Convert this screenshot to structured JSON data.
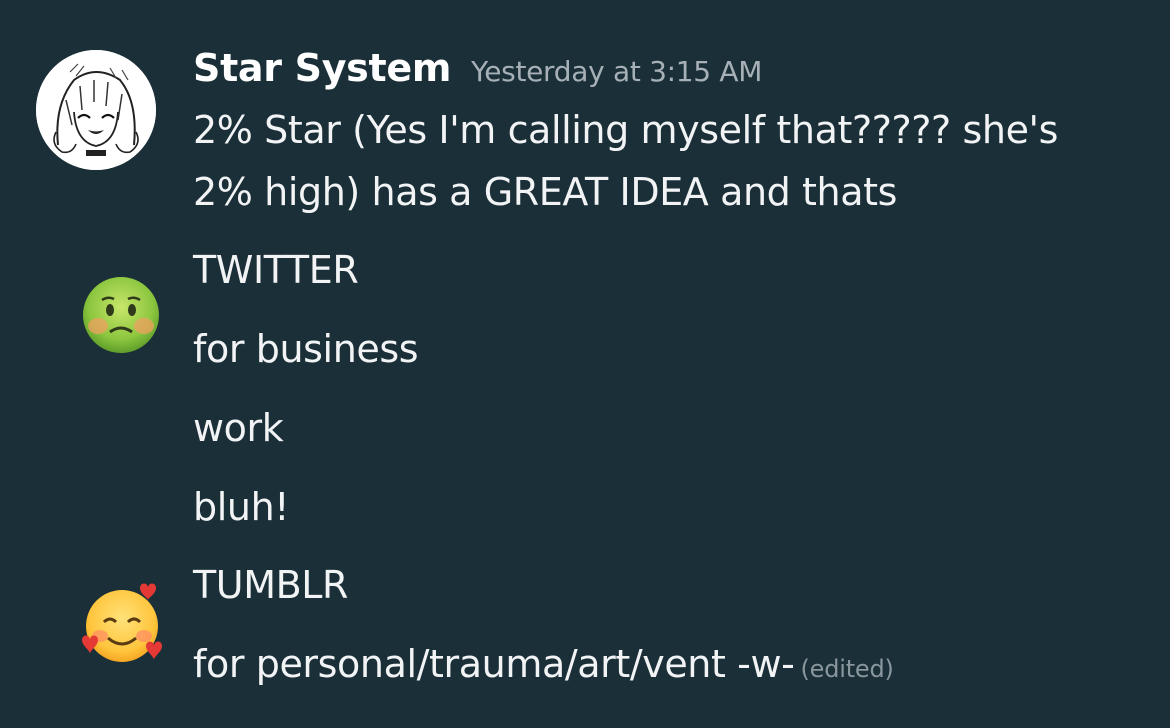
{
  "message": {
    "author": "Star System",
    "timestamp": "Yesterday at 3:15 AM",
    "lines": [
      "2% Star (Yes I'm calling myself that????? she's",
      "2% high) has a GREAT IDEA and thats",
      "TWITTER",
      "for business",
      "work",
      "bluh!",
      "TUMBLR",
      "for personal/trauma/art/vent -w-"
    ],
    "edited_label": "(edited)"
  },
  "emojis": {
    "sick": "nauseated-face-emoji",
    "hearts": "smiling-face-with-hearts-emoji"
  },
  "colors": {
    "background": "#1a2f37",
    "username": "#ffffff",
    "text": "#f2f3f5",
    "timestamp": "#a7b0b6",
    "edited": "#8a969d"
  }
}
